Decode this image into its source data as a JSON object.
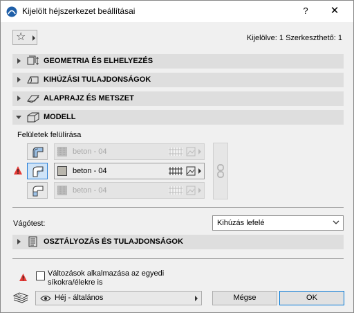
{
  "window": {
    "title": "Kijelölt héjszerkezet beállításai",
    "help_label": "?",
    "close_label": "✕"
  },
  "toolbar": {
    "selection_info": "Kijelölve: 1 Szerkeszthető: 1"
  },
  "sections": {
    "geometry": "GEOMETRIA ÉS ELHELYEZÉS",
    "extrusion": "KIHÚZÁSI TULAJDONSÁGOK",
    "floorplan": "ALAPRAJZ ÉS METSZET",
    "model": "MODELL",
    "classification": "OSZTÁLYOZÁS ÉS TULAJDONSÁGOK"
  },
  "model": {
    "surfaces_label": "Felületek felülírása",
    "surfaces": [
      {
        "name": "beton - 04",
        "active": false
      },
      {
        "name": "beton - 04",
        "active": true
      },
      {
        "name": "beton - 04",
        "active": false
      }
    ],
    "cut_label": "Vágótest:",
    "cut_value": "Kihúzás lefelé"
  },
  "footer": {
    "apply_checkbox_label": "Változások alkalmazása az egyedi síkokra/élekre is",
    "apply_checked": false,
    "view_label": "Héj - általános",
    "cancel_label": "Mégse",
    "ok_label": "OK"
  },
  "colors": {
    "accent": "#0078d7",
    "section_bg": "#dedede",
    "warning": "#e53935"
  }
}
